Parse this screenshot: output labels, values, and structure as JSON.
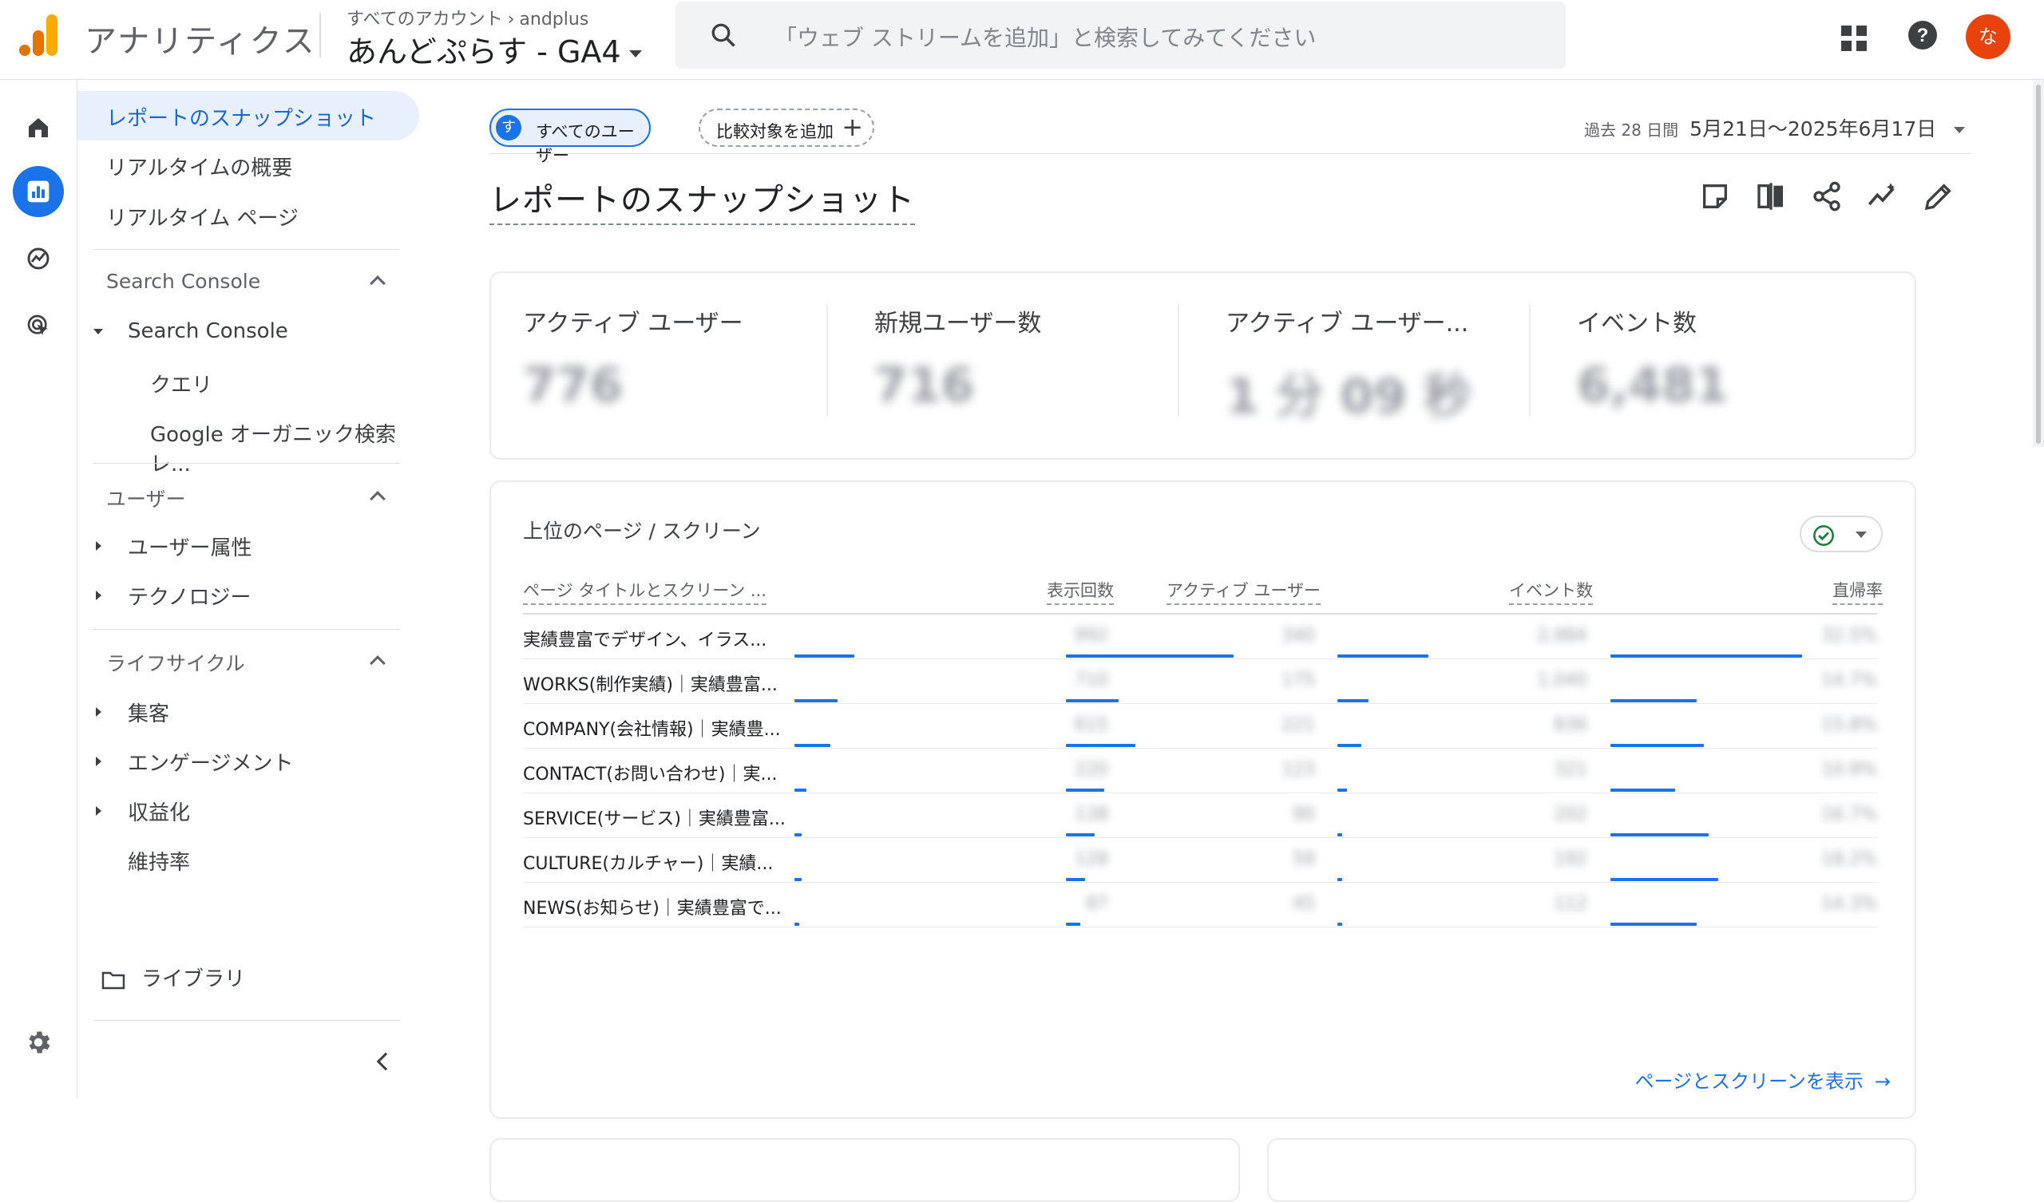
{
  "topbar": {
    "app_name": "アナリティクス",
    "breadcrumb_root": "すべてのアカウント",
    "breadcrumb_account": "andplus",
    "property": "あんどぷらす - GA4",
    "search_placeholder": "「ウェブ ストリームを追加」と検索してみてください",
    "avatar_initial": "な",
    "avatar_color": "#e8430c",
    "accent": "#1a73e8"
  },
  "sidenav": {
    "items_top": [
      {
        "label": "レポートのスナップショット",
        "active": true
      },
      {
        "label": "リアルタイムの概要"
      },
      {
        "label": "リアルタイム ページ"
      }
    ],
    "section_search_console": "Search Console",
    "search_console_group": "Search Console",
    "search_console_children": [
      "クエリ",
      "Google オーガニック検索レ..."
    ],
    "section_users": "ユーザー",
    "users_children": [
      "ユーザー属性",
      "テクノロジー"
    ],
    "section_lifecycle": "ライフサイクル",
    "lifecycle_children": [
      "集客",
      "エンゲージメント",
      "収益化",
      "維持率"
    ],
    "library": "ライブラリ"
  },
  "header": {
    "segment_chip": "すべてのユーザー",
    "segment_initial": "す",
    "compare_chip": "比較対象を追加",
    "date_prefix": "過去 28 日間",
    "date_range": "5月21日〜2025年6月17日",
    "page_title": "レポートのスナップショット"
  },
  "kpis": [
    {
      "label": "アクティブ ユーザー",
      "value": "776"
    },
    {
      "label": "新規ユーザー数",
      "value": "716"
    },
    {
      "label": "アクティブ ユーザー...",
      "value": "1 分 09 秒"
    },
    {
      "label": "イベント数",
      "value": "6,481"
    }
  ],
  "top_pages": {
    "title": "上位のページ / スクリーン",
    "columns": [
      "ページ タイトルとスクリーン ...",
      "表示回数",
      "アクティブ ユーザー",
      "イベント数",
      "直帰率"
    ],
    "rows": [
      {
        "title": "実績豊富でデザイン、イラス...",
        "views": "992",
        "users": "340",
        "events": "2,984",
        "bounce": "32.5%",
        "bars": [
          0.25,
          0.7,
          0.38,
          0.8
        ]
      },
      {
        "title": "WORKS(制作実績)｜実績豊富...",
        "views": "710",
        "users": "175",
        "events": "1,040",
        "bounce": "14.7%",
        "bars": [
          0.18,
          0.22,
          0.13,
          0.36
        ]
      },
      {
        "title": "COMPANY(会社情報)｜実績豊...",
        "views": "615",
        "users": "221",
        "events": "836",
        "bounce": "15.8%",
        "bars": [
          0.15,
          0.29,
          0.1,
          0.39
        ]
      },
      {
        "title": "CONTACT(お問い合わせ)｜実...",
        "views": "220",
        "users": "123",
        "events": "321",
        "bounce": "10.9%",
        "bars": [
          0.05,
          0.16,
          0.04,
          0.27
        ]
      },
      {
        "title": "SERVICE(サービス)｜実績豊富...",
        "views": "138",
        "users": "90",
        "events": "202",
        "bounce": "16.7%",
        "bars": [
          0.03,
          0.12,
          0.02,
          0.41
        ]
      },
      {
        "title": "CULTURE(カルチャー)｜実績...",
        "views": "128",
        "users": "59",
        "events": "192",
        "bounce": "18.2%",
        "bars": [
          0.03,
          0.08,
          0.02,
          0.45
        ]
      },
      {
        "title": "NEWS(お知らせ)｜実績豊富で...",
        "views": "87",
        "users": "45",
        "events": "112",
        "bounce": "14.3%",
        "bars": [
          0.02,
          0.06,
          0.02,
          0.36
        ]
      }
    ],
    "view_link": "ページとスクリーンを表示"
  }
}
